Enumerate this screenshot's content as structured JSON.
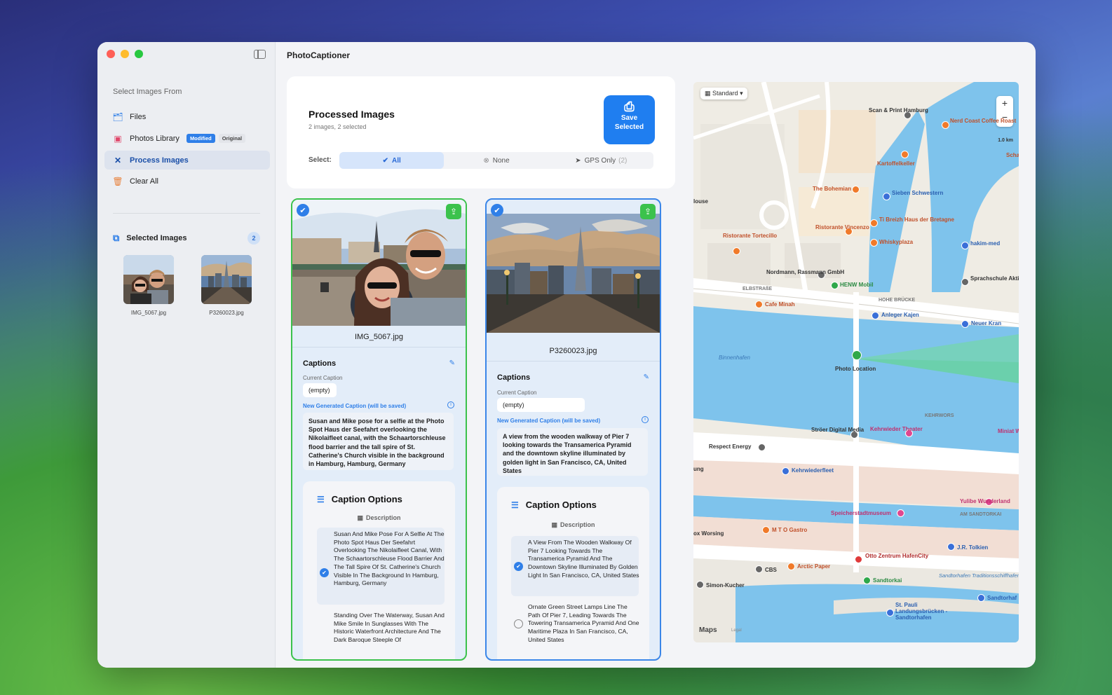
{
  "app": {
    "title": "PhotoCaptioner"
  },
  "sidebar": {
    "section_title": "Select Images From",
    "items": [
      {
        "label": "Files",
        "icon": "files-icon"
      },
      {
        "label": "Photos Library",
        "icon": "photos-icon",
        "badge_modified": "Modified",
        "badge_original": "Original"
      },
      {
        "label": "Process Images",
        "icon": "wand-icon",
        "active": true
      },
      {
        "label": "Clear All",
        "icon": "trash-icon"
      }
    ],
    "selected_title": "Selected Images",
    "selected_count": "2",
    "thumbnails": [
      {
        "label": "IMG_5067.jpg"
      },
      {
        "label": "P3260023.jpg"
      }
    ]
  },
  "processed": {
    "title": "Processed Images",
    "subtitle": "2 images, 2 selected",
    "save_label_1": "Save",
    "save_label_2": "Selected",
    "select_label": "Select:",
    "seg_all": "All",
    "seg_none": "None",
    "seg_gps": "GPS Only",
    "seg_gps_count": "(2)"
  },
  "cards": [
    {
      "filename": "IMG_5067.jpg",
      "captions_title": "Captions",
      "current_caption_label": "Current Caption",
      "current_caption": "(empty)",
      "new_caption_label": "New Generated Caption (will be saved)",
      "new_caption": "Susan and Mike pose for a selfie at the Photo Spot Haus der Seefahrt overlooking the Nikolaifleet canal, with the Schaartorschleuse flood barrier and the tall spire of St. Catherine's Church visible in the background in Hamburg, Hamburg, Germany",
      "options_title": "Caption Options",
      "description_label": "Description",
      "option_1": "Susan And Mike Pose For A Selfie At The Photo Spot Haus Der Seefahrt Overlooking The Nikolaifleet Canal, With The Schaartorschleuse Flood Barrier And The Tall Spire Of St. Catherine's Church Visible In The Background In Hamburg, Hamburg, Germany",
      "option_2": "Standing Over The Waterway, Susan And Mike Smile In Sunglasses With The Historic Waterfront Architecture And The Dark Baroque Steeple Of"
    },
    {
      "filename": "P3260023.jpg",
      "captions_title": "Captions",
      "current_caption_label": "Current Caption",
      "current_caption": "(empty)",
      "new_caption_label": "New Generated Caption (will be saved)",
      "new_caption": "A view from the wooden walkway of Pier 7 looking towards the Transamerica Pyramid and the downtown skyline illuminated by golden light in San Francisco, CA, United States",
      "options_title": "Caption Options",
      "description_label": "Description",
      "option_1": "A View From The Wooden Walkway Of Pier 7 Looking Towards The Transamerica Pyramid And The Downtown Skyline Illuminated By Golden Light In San Francisco, CA, United States",
      "option_2": "Ornate Green Street Lamps Line The Path Of Pier 7, Leading Towards The Towering Transamerica Pyramid And One Maritime Plaza In San Francisco, CA, United States"
    }
  ],
  "map": {
    "style_label": "Standard",
    "scale": "1.0 km",
    "attribution": "Maps",
    "legal": "Legal",
    "labels": [
      {
        "t": "Scan & Print Hamburg"
      },
      {
        "t": "Nerd Coast Coffee Roast"
      },
      {
        "t": "Kartoffelkeller"
      },
      {
        "t": "The Bohemian"
      },
      {
        "t": "Sieben Schwestern"
      },
      {
        "t": "Ristorante Tortecillo"
      },
      {
        "t": "Ristorante Vincenzo"
      },
      {
        "t": "Ti Breizh Haus der Bretagne"
      },
      {
        "t": "Whiskyplaza"
      },
      {
        "t": "hakim-med"
      },
      {
        "t": "Nordmann, Rassmann GmbH"
      },
      {
        "t": "HENW Mobil"
      },
      {
        "t": "Sprachschule Aktiv Hamburg"
      },
      {
        "t": "Cafe Minah"
      },
      {
        "t": "Anleger Kajen"
      },
      {
        "t": "Neuer Kran"
      },
      {
        "t": "Binnenhafen"
      },
      {
        "t": "Photo Location"
      },
      {
        "t": "Respect Energy"
      },
      {
        "t": "Ströer Digital Media"
      },
      {
        "t": "Kehrwieder Theater"
      },
      {
        "t": "Kehrwiederfleet"
      },
      {
        "t": "Speicherstadtmuseum"
      },
      {
        "t": "Yulibe Wunderland"
      },
      {
        "t": "M T O Gastro"
      },
      {
        "t": "J.R. Tolkien"
      },
      {
        "t": "CBS"
      },
      {
        "t": "Arctic Paper"
      },
      {
        "t": "Otto Zentrum HafenCity"
      },
      {
        "t": "Sandtorkai"
      },
      {
        "t": "Simon-Kucher"
      },
      {
        "t": "Sandtorhafen Traditionsschiffhafen"
      },
      {
        "t": "Sandtorhaf"
      },
      {
        "t": "St. Pauli Landungsbrücken - Sandtorhafen"
      },
      {
        "t": "ox Worsing"
      },
      {
        "t": "ung"
      },
      {
        "t": "louse"
      },
      {
        "t": "Schar"
      },
      {
        "t": "Miniat Wunde"
      }
    ],
    "street_labels": [
      "ELBSTRAßE",
      "HOHE BRÜCKE",
      "KEHRWORS",
      "AM SANDTORKAI"
    ]
  }
}
